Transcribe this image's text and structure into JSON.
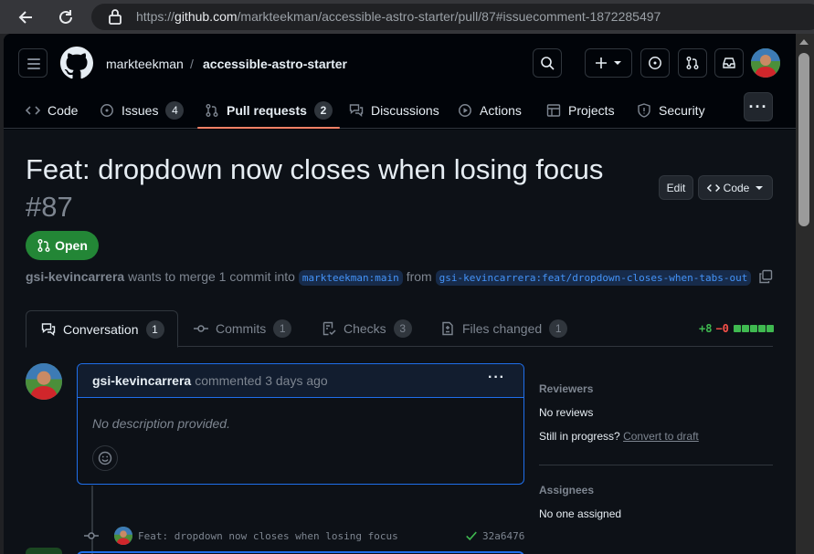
{
  "browser": {
    "url_scheme": "https://",
    "url_host": "github.com",
    "url_path": "/markteekman/accessible-astro-starter/pull/87#issuecomment-1872285497"
  },
  "header": {
    "owner": "markteekman",
    "separator": "/",
    "repo": "accessible-astro-starter"
  },
  "nav": {
    "code": "Code",
    "issues": "Issues",
    "issues_count": "4",
    "pulls": "Pull requests",
    "pulls_count": "2",
    "discussions": "Discussions",
    "actions": "Actions",
    "projects": "Projects",
    "security": "Security"
  },
  "pr": {
    "title": "Feat: dropdown now closes when losing focus",
    "number": "#87",
    "edit": "Edit",
    "code": "Code",
    "state": "Open",
    "author": "gsi-kevincarrera",
    "merge_text": "wants to merge 1 commit into",
    "base": "markteekman:main",
    "from": "from",
    "head": "gsi-kevincarrera:feat/dropdown-closes-when-tabs-out"
  },
  "tabs": {
    "conversation": "Conversation",
    "conversation_count": "1",
    "commits": "Commits",
    "commits_count": "1",
    "checks": "Checks",
    "checks_count": "3",
    "files": "Files changed",
    "files_count": "1",
    "additions": "+8",
    "deletions": "−0"
  },
  "comment": {
    "author": "gsi-kevincarrera",
    "action": "commented 3 days ago",
    "body": "No description provided."
  },
  "commit": {
    "message": "Feat: dropdown now closes when losing focus",
    "sha": "32a6476"
  },
  "sidebar": {
    "reviewers_title": "Reviewers",
    "reviewers_value": "No reviews",
    "in_progress": "Still in progress?",
    "convert": "Convert to draft",
    "assignees_title": "Assignees",
    "assignees_value": "No one assigned"
  },
  "colors": {
    "accent": "#1f6feb",
    "open": "#238636",
    "underline": "#f78166"
  }
}
